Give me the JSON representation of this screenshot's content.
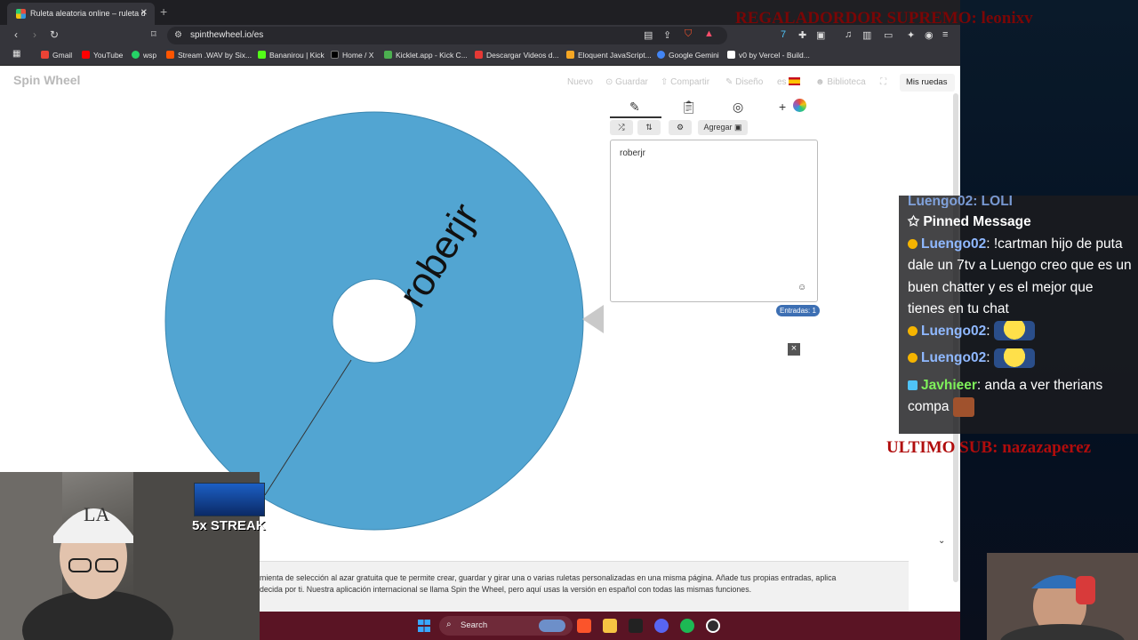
{
  "browser": {
    "tab_title": "Ruleta aleatoria online – ruleta d",
    "tab_close": "✕",
    "new_tab": "+",
    "url": "spinthewheel.io/es",
    "bookmarks": [
      {
        "label": "Gmail",
        "color": "#ea4335"
      },
      {
        "label": "YouTube",
        "color": "#ff0000"
      },
      {
        "label": "wsp",
        "color": "#25d366"
      },
      {
        "label": "Stream .WAV by Six...",
        "color": "#ff5500"
      },
      {
        "label": "Bananirou | Kick",
        "color": "#53fc18"
      },
      {
        "label": "Home / X",
        "color": "#000000"
      },
      {
        "label": "Kicklet.app - Kick C...",
        "color": "#4caf50"
      },
      {
        "label": "Descargar Videos d...",
        "color": "#e53935"
      },
      {
        "label": "Eloquent JavaScript...",
        "color": "#f5a623"
      },
      {
        "label": "Google Gemini",
        "color": "#4285f4"
      },
      {
        "label": "v0 by Vercel - Build...",
        "color": "#ffffff"
      }
    ]
  },
  "site": {
    "logo": "Spin Wheel",
    "nav": [
      "Nuevo",
      "Guardar",
      "Compartir",
      "Diseño",
      "es",
      "Biblioteca"
    ],
    "my_wheels": "Mis ruedas",
    "wheel_entry": "roberjr",
    "wheel_color": "#52a5d2",
    "editor_add": "Agregar",
    "entries_text": "roberjr",
    "entries_count": "Entradas: 1",
    "close_ad": "×",
    "description_line1": "mienta de selección al azar gratuita que te permite crear, guardar y girar una o varias ruletas personalizadas en una misma página. Añade tus propias entradas, aplica",
    "description_line2": "decida por ti. Nuestra aplicación internacional se llama Spin the Wheel, pero aquí usas la versión en español con todas las mismas funciones."
  },
  "taskbar": {
    "search_placeholder": "Search"
  },
  "stream": {
    "top_overlay": "REGALADORDOR SUPREMO: leonixv",
    "last_sub": "ULTIMO SUB: nazazaperez",
    "streak": "5x STREAK",
    "chat_header_partial": "Luengo02: LOLI",
    "pinned_label": "Pinned Message",
    "messages": [
      {
        "user": "Luengo02",
        "color": "#8fb8ff",
        "text": ": !cartman hijo de puta dale un 7tv a Luengo creo que es un buen chatter y es el mejor que tienes en tu chat"
      },
      {
        "user": "Luengo02",
        "color": "#8fb8ff",
        "text": ":"
      },
      {
        "user": "Luengo02",
        "color": "#8fb8ff",
        "text": ":"
      },
      {
        "user": "Javhieer",
        "color": "#7ef05a",
        "text": ": anda a ver therians compa"
      }
    ]
  }
}
